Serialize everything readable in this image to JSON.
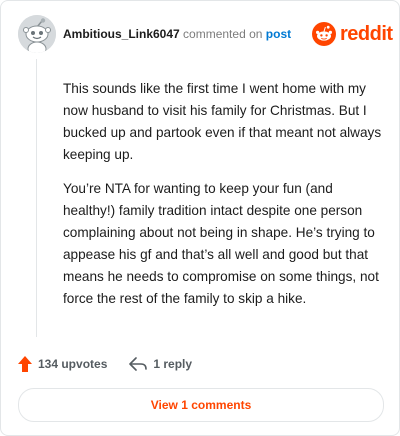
{
  "comment": {
    "username": "Ambitious_Link6047",
    "action_text": "commented on",
    "target_link": "post",
    "paragraphs": [
      "This sounds like the first time I went home with my now husband to visit his family for Christmas. But I bucked up and partook even if that meant not always keeping up.",
      "You’re NTA for wanting to keep your fun (and healthy!) family tradition intact despite one person complaining about not being in shape. He’s trying to appease his gf and that’s all well and good but that means he needs to compromise on some things, not force the rest of the family to skip a hike."
    ],
    "upvotes_label": "134 upvotes",
    "reply_label": "1 reply",
    "view_comments_label": "View 1 comments"
  },
  "brand": {
    "name": "reddit",
    "icon": "reddit-snoo-icon",
    "color": "#ff4500"
  },
  "colors": {
    "accent": "#ff4500",
    "link": "#0079d3",
    "muted": "#7c7c7c"
  }
}
